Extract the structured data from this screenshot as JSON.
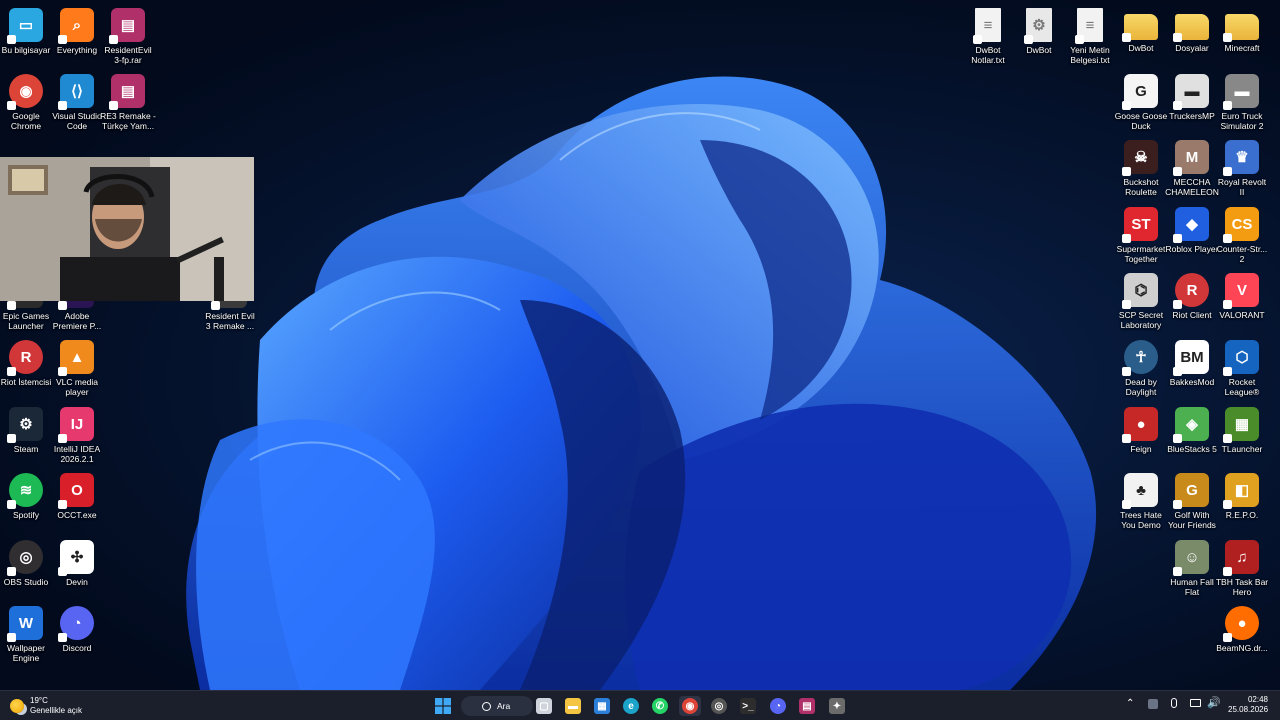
{
  "desktop": {
    "icons_left": [
      {
        "label": "Bu bilgisayar",
        "icon": "monitor-icon",
        "color": "#2aa6e0"
      },
      {
        "label": "Everything",
        "icon": "magnifier-icon",
        "color": "#ff7a1a"
      },
      {
        "label": "ResidentEvil\n3-fp.rar",
        "icon": "winrar-icon",
        "color": "#b0306a"
      },
      {
        "label": "Google\nChrome",
        "icon": "chrome-icon",
        "color": "#db4437"
      },
      {
        "label": "Visual Studio\nCode",
        "icon": "vscode-icon",
        "color": "#1f8ad2"
      },
      {
        "label": "RE3 Remake -\nTürkçe Yam...",
        "icon": "winrar-icon",
        "color": "#b0306a"
      },
      {
        "label": "Epic Games\nLauncher",
        "icon": "epic-icon",
        "color": "#2b2b2b"
      },
      {
        "label": "Adobe\nPremiere P...",
        "icon": "premiere-icon",
        "color": "#2a1454"
      },
      {
        "label": "Resident Evil\n3 Remake ...",
        "icon": "game-icon",
        "color": "#3a3a3a"
      },
      {
        "label": "Riot İstemcisi",
        "icon": "riot-icon",
        "color": "#d13639"
      },
      {
        "label": "VLC media\nplayer",
        "icon": "vlc-icon",
        "color": "#f08a1c"
      },
      {
        "label": "Steam",
        "icon": "steam-icon",
        "color": "#1b2838"
      },
      {
        "label": "IntelliJ IDEA\n2026.2.1",
        "icon": "intellij-icon",
        "color": "#e63a6e"
      },
      {
        "label": "Spotify",
        "icon": "spotify-icon",
        "color": "#1db954"
      },
      {
        "label": "OCCT.exe",
        "icon": "occt-icon",
        "color": "#d9202a"
      },
      {
        "label": "OBS Studio",
        "icon": "obs-icon",
        "color": "#302e31"
      },
      {
        "label": "Devin",
        "icon": "devin-icon",
        "color": "#ffffff"
      },
      {
        "label": "Wallpaper\nEngine",
        "icon": "wallpaper-engine-icon",
        "color": "#1e6fd9"
      },
      {
        "label": "Discord",
        "icon": "discord-icon",
        "color": "#5865f2"
      }
    ],
    "icons_right": [
      {
        "label": "DwBot\nNotlar.txt",
        "icon": "text-file-icon",
        "color": "#f2f2f2"
      },
      {
        "label": "DwBot",
        "icon": "settings-file-icon",
        "color": "#e8e8e8"
      },
      {
        "label": "Yeni Metin\nBelgesi.txt",
        "icon": "text-file-icon",
        "color": "#f2f2f2"
      },
      {
        "label": "DwBot",
        "icon": "folder-icon",
        "color": "#f4c542"
      },
      {
        "label": "Dosyalar",
        "icon": "folder-icon",
        "color": "#f4c542"
      },
      {
        "label": "Minecraft",
        "icon": "folder-icon",
        "color": "#f4c542"
      },
      {
        "label": "Goose Goose\nDuck",
        "icon": "goose-icon",
        "color": "#f5f5f5"
      },
      {
        "label": "TruckersMP",
        "icon": "truck-icon",
        "color": "#e0e0e0"
      },
      {
        "label": "Euro Truck\nSimulator 2",
        "icon": "truck-icon",
        "color": "#888888"
      },
      {
        "label": "Buckshot\nRoulette",
        "icon": "buckshot-icon",
        "color": "#3b1f1f"
      },
      {
        "label": "MECCHA\nCHAMELEON",
        "icon": "chameleon-icon",
        "color": "#9a7b6b"
      },
      {
        "label": "Royal Revolt\nII",
        "icon": "royal-revolt-icon",
        "color": "#3a6fd0"
      },
      {
        "label": "Supermarket\nTogether",
        "icon": "supermarket-icon",
        "color": "#e0262f"
      },
      {
        "label": "Roblox Player",
        "icon": "roblox-icon",
        "color": "#1f5fe0"
      },
      {
        "label": "Counter-Str...\n2",
        "icon": "cs2-icon",
        "color": "#f39c12"
      },
      {
        "label": "SCP Secret\nLaboratory",
        "icon": "scp-icon",
        "color": "#cfcfcf"
      },
      {
        "label": "Riot Client",
        "icon": "riot-icon",
        "color": "#d13639"
      },
      {
        "label": "VALORANT",
        "icon": "valorant-icon",
        "color": "#fd4556"
      },
      {
        "label": "Dead by\nDaylight",
        "icon": "dbd-icon",
        "color": "#2a5d8a"
      },
      {
        "label": "BakkesMod",
        "icon": "bakkesmod-icon",
        "color": "#ffffff"
      },
      {
        "label": "Rocket\nLeague®",
        "icon": "rocket-league-icon",
        "color": "#1565c0"
      },
      {
        "label": "Feign",
        "icon": "feign-icon",
        "color": "#c62828"
      },
      {
        "label": "BlueStacks 5",
        "icon": "bluestacks-icon",
        "color": "#4caf50"
      },
      {
        "label": "TLauncher",
        "icon": "tlauncher-icon",
        "color": "#4a8c2a"
      },
      {
        "label": "Trees Hate\nYou Demo",
        "icon": "tree-icon",
        "color": "#f2f2f2"
      },
      {
        "label": "Golf With\nYour Friends",
        "icon": "golf-icon",
        "color": "#c88a1a"
      },
      {
        "label": "R.E.P.O.",
        "icon": "repo-icon",
        "color": "#e0a020"
      },
      {
        "label": "Human Fall\nFlat",
        "icon": "human-fall-flat-icon",
        "color": "#7a8b6a"
      },
      {
        "label": "TBH Task Bar\nHero",
        "icon": "tbh-icon",
        "color": "#b02020"
      },
      {
        "label": "BeamNG.dr...",
        "icon": "beamng-icon",
        "color": "#ff6d00"
      }
    ]
  },
  "webcam": {
    "description_icon": "webcam-overlay"
  },
  "taskbar": {
    "weather": {
      "temp": "19°C",
      "condition": "Genellikle açık"
    },
    "search_label": "Ara",
    "apps": [
      {
        "name": "start-button",
        "icon": "windows-icon",
        "color": "#3fa9f5"
      },
      {
        "name": "task-view-button",
        "icon": "task-view-icon",
        "color": "#cfd4dc"
      },
      {
        "name": "file-explorer-button",
        "icon": "folder-icon",
        "color": "#f4c542"
      },
      {
        "name": "store-button",
        "icon": "store-icon",
        "color": "#2b7fd8"
      },
      {
        "name": "edge-button",
        "icon": "edge-icon",
        "color": "#1ca3c9"
      },
      {
        "name": "whatsapp-button",
        "icon": "whatsapp-icon",
        "color": "#25d366"
      },
      {
        "name": "chrome-button",
        "icon": "chrome-icon",
        "color": "#db4437"
      },
      {
        "name": "obs-button",
        "icon": "obs-icon",
        "color": "#555555"
      },
      {
        "name": "terminal-button",
        "icon": "terminal-icon",
        "color": "#2d2d2d"
      },
      {
        "name": "discord-button",
        "icon": "discord-icon",
        "color": "#5865f2"
      },
      {
        "name": "winrar-button",
        "icon": "winrar-icon",
        "color": "#b0306a"
      },
      {
        "name": "dwbot-button",
        "icon": "bot-icon",
        "color": "#6b6b6b"
      }
    ],
    "clock": {
      "time": "02:48",
      "date": "25.08.2026"
    }
  }
}
